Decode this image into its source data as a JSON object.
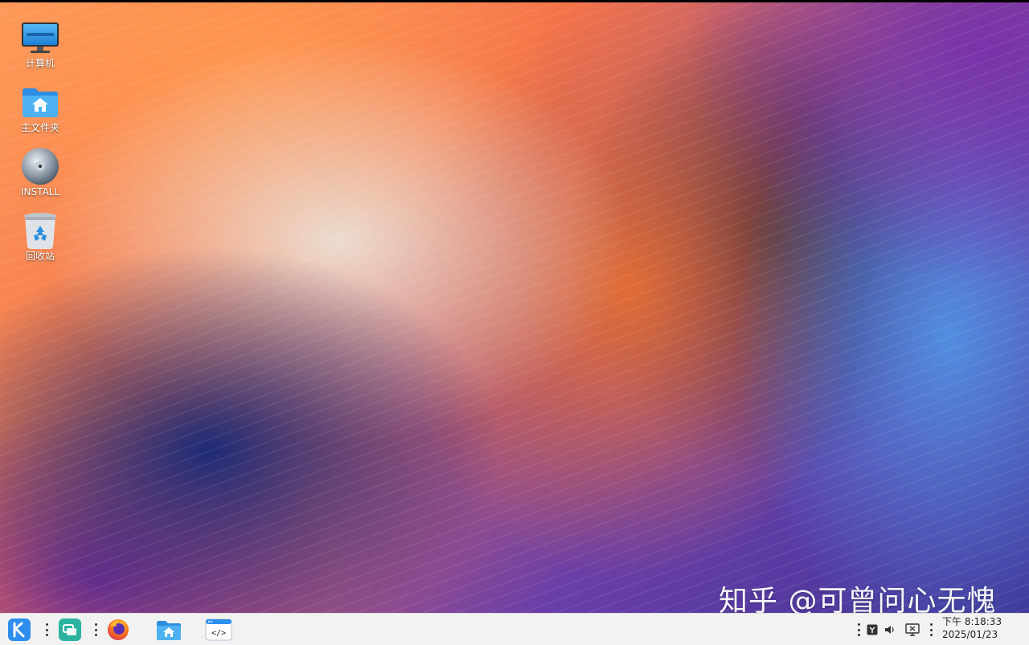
{
  "desktop": {
    "icons": [
      {
        "label": "计算机",
        "icon": "computer-icon"
      },
      {
        "label": "主文件夹",
        "icon": "home-folder-icon"
      },
      {
        "label": "INSTALL",
        "icon": "disc-icon"
      },
      {
        "label": "回收站",
        "icon": "trash-icon"
      }
    ],
    "watermark": "知乎 @可曾问心无愧"
  },
  "taskbar": {
    "start_icon": "kylin-start-icon",
    "multitask_icon": "multitask-view-icon",
    "pinned": [
      {
        "name": "firefox",
        "icon": "firefox-icon"
      },
      {
        "name": "file-manager",
        "icon": "folder-home-icon"
      },
      {
        "name": "code-editor",
        "icon": "code-editor-icon"
      }
    ],
    "tray": [
      "input-method-icon",
      "volume-icon",
      "network-icon"
    ],
    "clock": {
      "time": "下午 8:18:33",
      "date": "2025/01/23"
    }
  },
  "colors": {
    "taskbar_bg": "#f2f2f2",
    "start_blue": "#2d8ef0",
    "multitask_teal": "#2bb3a0",
    "firefox_orange": "#ff7a1a",
    "folder_blue": "#3aa0e8"
  }
}
